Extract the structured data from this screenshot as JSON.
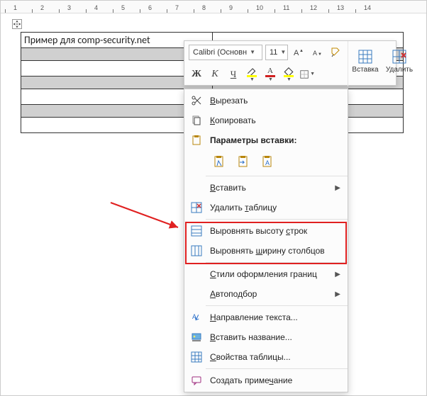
{
  "ruler": {
    "marks": [
      1,
      2,
      3,
      4,
      5,
      6,
      7,
      8,
      9,
      10,
      11,
      12,
      13,
      14
    ]
  },
  "table": {
    "cellA1": "Пример для comp-security.net"
  },
  "mini_toolbar": {
    "font_name": "Calibri (Основн",
    "font_size": "11",
    "grow_font_tip": "Увеличить размер",
    "shrink_font_tip": "Уменьшить размер",
    "format_painter_tip": "Формат по образцу",
    "insert_label": "Вставка",
    "delete_label": "Удалить",
    "bold_label": "Ж",
    "italic_label": "К",
    "underline_label": "Ч"
  },
  "context_menu": {
    "cut": "Вырезать",
    "copy": "Копировать",
    "paste_options_heading": "Параметры вставки:",
    "insert": "Вставить",
    "delete_table": "Удалить таблицу",
    "distribute_rows": "Выровнять высоту строк",
    "distribute_cols": "Выровнять ширину столбцов",
    "border_styles": "Стили оформления границ",
    "autofit": "Автоподбор",
    "text_direction": "Направление текста...",
    "insert_caption": "Вставить название...",
    "table_properties": "Свойства таблицы...",
    "new_comment": "Создать примечание"
  }
}
